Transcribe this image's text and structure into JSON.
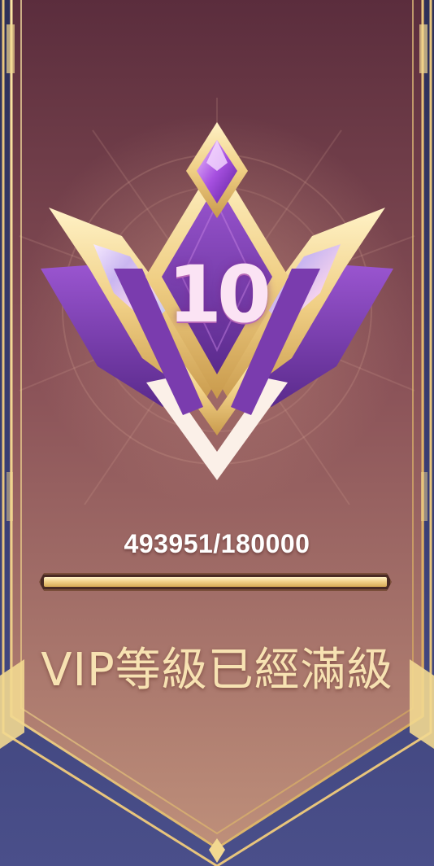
{
  "vip": {
    "level": "10",
    "progress_text": "493951/180000",
    "progress_fill_fraction": 1.0,
    "status_message": "VIP等級已經滿級"
  },
  "icons": {
    "emblem": "crown-wing-emblem-icon",
    "gem": "purple-gem-icon"
  },
  "colors": {
    "banner_top": "#5b2d3d",
    "banner_bottom": "#bd8c78",
    "gold": "#f0d38d",
    "purple": "#7b3fb0",
    "text_gold": "#f7e2b2"
  }
}
